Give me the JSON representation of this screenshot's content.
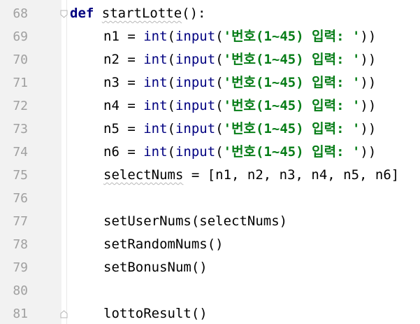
{
  "editor": {
    "lines": [
      {
        "num": "68",
        "parts": [
          {
            "t": "def",
            "c": "kw"
          },
          {
            "t": " "
          },
          {
            "t": "startLotte",
            "c": "fn wavy"
          },
          {
            "t": "():"
          }
        ],
        "indent": false,
        "fold": "start"
      },
      {
        "num": "69",
        "parts": [
          {
            "t": "n1 = "
          },
          {
            "t": "int",
            "c": "bi"
          },
          {
            "t": "("
          },
          {
            "t": "input",
            "c": "bi"
          },
          {
            "t": "("
          },
          {
            "t": "'번호(1~45) 입력: '",
            "c": "st"
          },
          {
            "t": "))"
          }
        ],
        "indent": true
      },
      {
        "num": "70",
        "parts": [
          {
            "t": "n2 = "
          },
          {
            "t": "int",
            "c": "bi"
          },
          {
            "t": "("
          },
          {
            "t": "input",
            "c": "bi"
          },
          {
            "t": "("
          },
          {
            "t": "'번호(1~45) 입력: '",
            "c": "st"
          },
          {
            "t": "))"
          }
        ],
        "indent": true
      },
      {
        "num": "71",
        "parts": [
          {
            "t": "n3 = "
          },
          {
            "t": "int",
            "c": "bi"
          },
          {
            "t": "("
          },
          {
            "t": "input",
            "c": "bi"
          },
          {
            "t": "("
          },
          {
            "t": "'번호(1~45) 입력: '",
            "c": "st"
          },
          {
            "t": "))"
          }
        ],
        "indent": true
      },
      {
        "num": "72",
        "parts": [
          {
            "t": "n4 = "
          },
          {
            "t": "int",
            "c": "bi"
          },
          {
            "t": "("
          },
          {
            "t": "input",
            "c": "bi"
          },
          {
            "t": "("
          },
          {
            "t": "'번호(1~45) 입력: '",
            "c": "st"
          },
          {
            "t": "))"
          }
        ],
        "indent": true
      },
      {
        "num": "73",
        "parts": [
          {
            "t": "n5 = "
          },
          {
            "t": "int",
            "c": "bi"
          },
          {
            "t": "("
          },
          {
            "t": "input",
            "c": "bi"
          },
          {
            "t": "("
          },
          {
            "t": "'번호(1~45) 입력: '",
            "c": "st"
          },
          {
            "t": "))"
          }
        ],
        "indent": true
      },
      {
        "num": "74",
        "parts": [
          {
            "t": "n6 = "
          },
          {
            "t": "int",
            "c": "bi"
          },
          {
            "t": "("
          },
          {
            "t": "input",
            "c": "bi"
          },
          {
            "t": "("
          },
          {
            "t": "'번호(1~45) 입력: '",
            "c": "st"
          },
          {
            "t": "))"
          }
        ],
        "indent": true
      },
      {
        "num": "75",
        "parts": [
          {
            "t": "selectNums",
            "c": "wavy"
          },
          {
            "t": " = [n1, n2, n3, n4, n5, n6]"
          }
        ],
        "indent": true
      },
      {
        "num": "76",
        "parts": [],
        "indent": true
      },
      {
        "num": "77",
        "parts": [
          {
            "t": "setUserNums(selectNums)"
          }
        ],
        "indent": true
      },
      {
        "num": "78",
        "parts": [
          {
            "t": "setRandomNums()"
          }
        ],
        "indent": true
      },
      {
        "num": "79",
        "parts": [
          {
            "t": "setBonusNum()"
          }
        ],
        "indent": true
      },
      {
        "num": "80",
        "parts": [],
        "indent": true
      },
      {
        "num": "81",
        "parts": [
          {
            "t": "lottoResult()"
          }
        ],
        "indent": true,
        "fold": "end"
      }
    ]
  },
  "colors": {
    "keyword": "#000080",
    "builtin": "#000080",
    "string": "#067d17",
    "line_number": "#a0a0a0",
    "gutter": "#f2f2f2"
  }
}
